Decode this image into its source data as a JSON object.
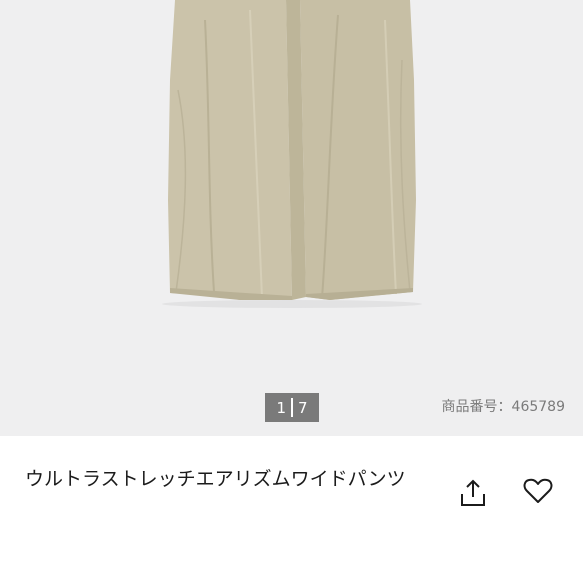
{
  "gallery": {
    "index": "1",
    "total": "7"
  },
  "product": {
    "number_label": "商品番号：465789",
    "name": "ウルトラストレッチエアリズムワイドパンツ"
  },
  "actions": {
    "share_icon": "share-icon",
    "favorite_icon": "heart-icon"
  },
  "colors": {
    "background": "#efeff0",
    "pants": "#c9c1a8",
    "counter_bg": "#7a7a7a"
  }
}
